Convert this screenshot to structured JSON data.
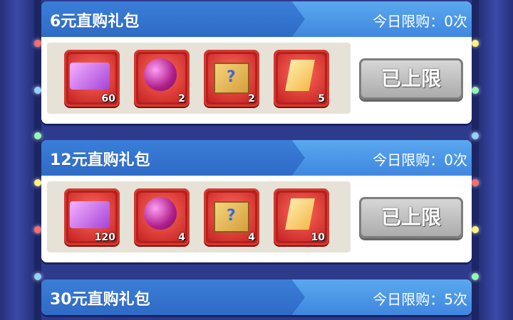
{
  "colors": {
    "header_blue": "#3f87df",
    "item_red": "#b51f1f",
    "button_gray": "#a9a9a9"
  },
  "packs": [
    {
      "title": "6元直购礼包",
      "limit_label": "今日限购：",
      "limit_value": "0次",
      "button": "已上限",
      "items": [
        {
          "name": "card-ticket",
          "count": "60"
        },
        {
          "name": "pink-orb",
          "count": "2"
        },
        {
          "name": "mystery-box",
          "count": "2"
        },
        {
          "name": "gold-ticket",
          "count": "5"
        }
      ]
    },
    {
      "title": "12元直购礼包",
      "limit_label": "今日限购：",
      "limit_value": "0次",
      "button": "已上限",
      "items": [
        {
          "name": "card-ticket",
          "count": "120"
        },
        {
          "name": "pink-orb",
          "count": "4"
        },
        {
          "name": "mystery-box",
          "count": "4"
        },
        {
          "name": "gold-ticket",
          "count": "10"
        }
      ]
    },
    {
      "title": "30元直购礼包",
      "limit_label": "今日限购：",
      "limit_value": "5次"
    }
  ]
}
